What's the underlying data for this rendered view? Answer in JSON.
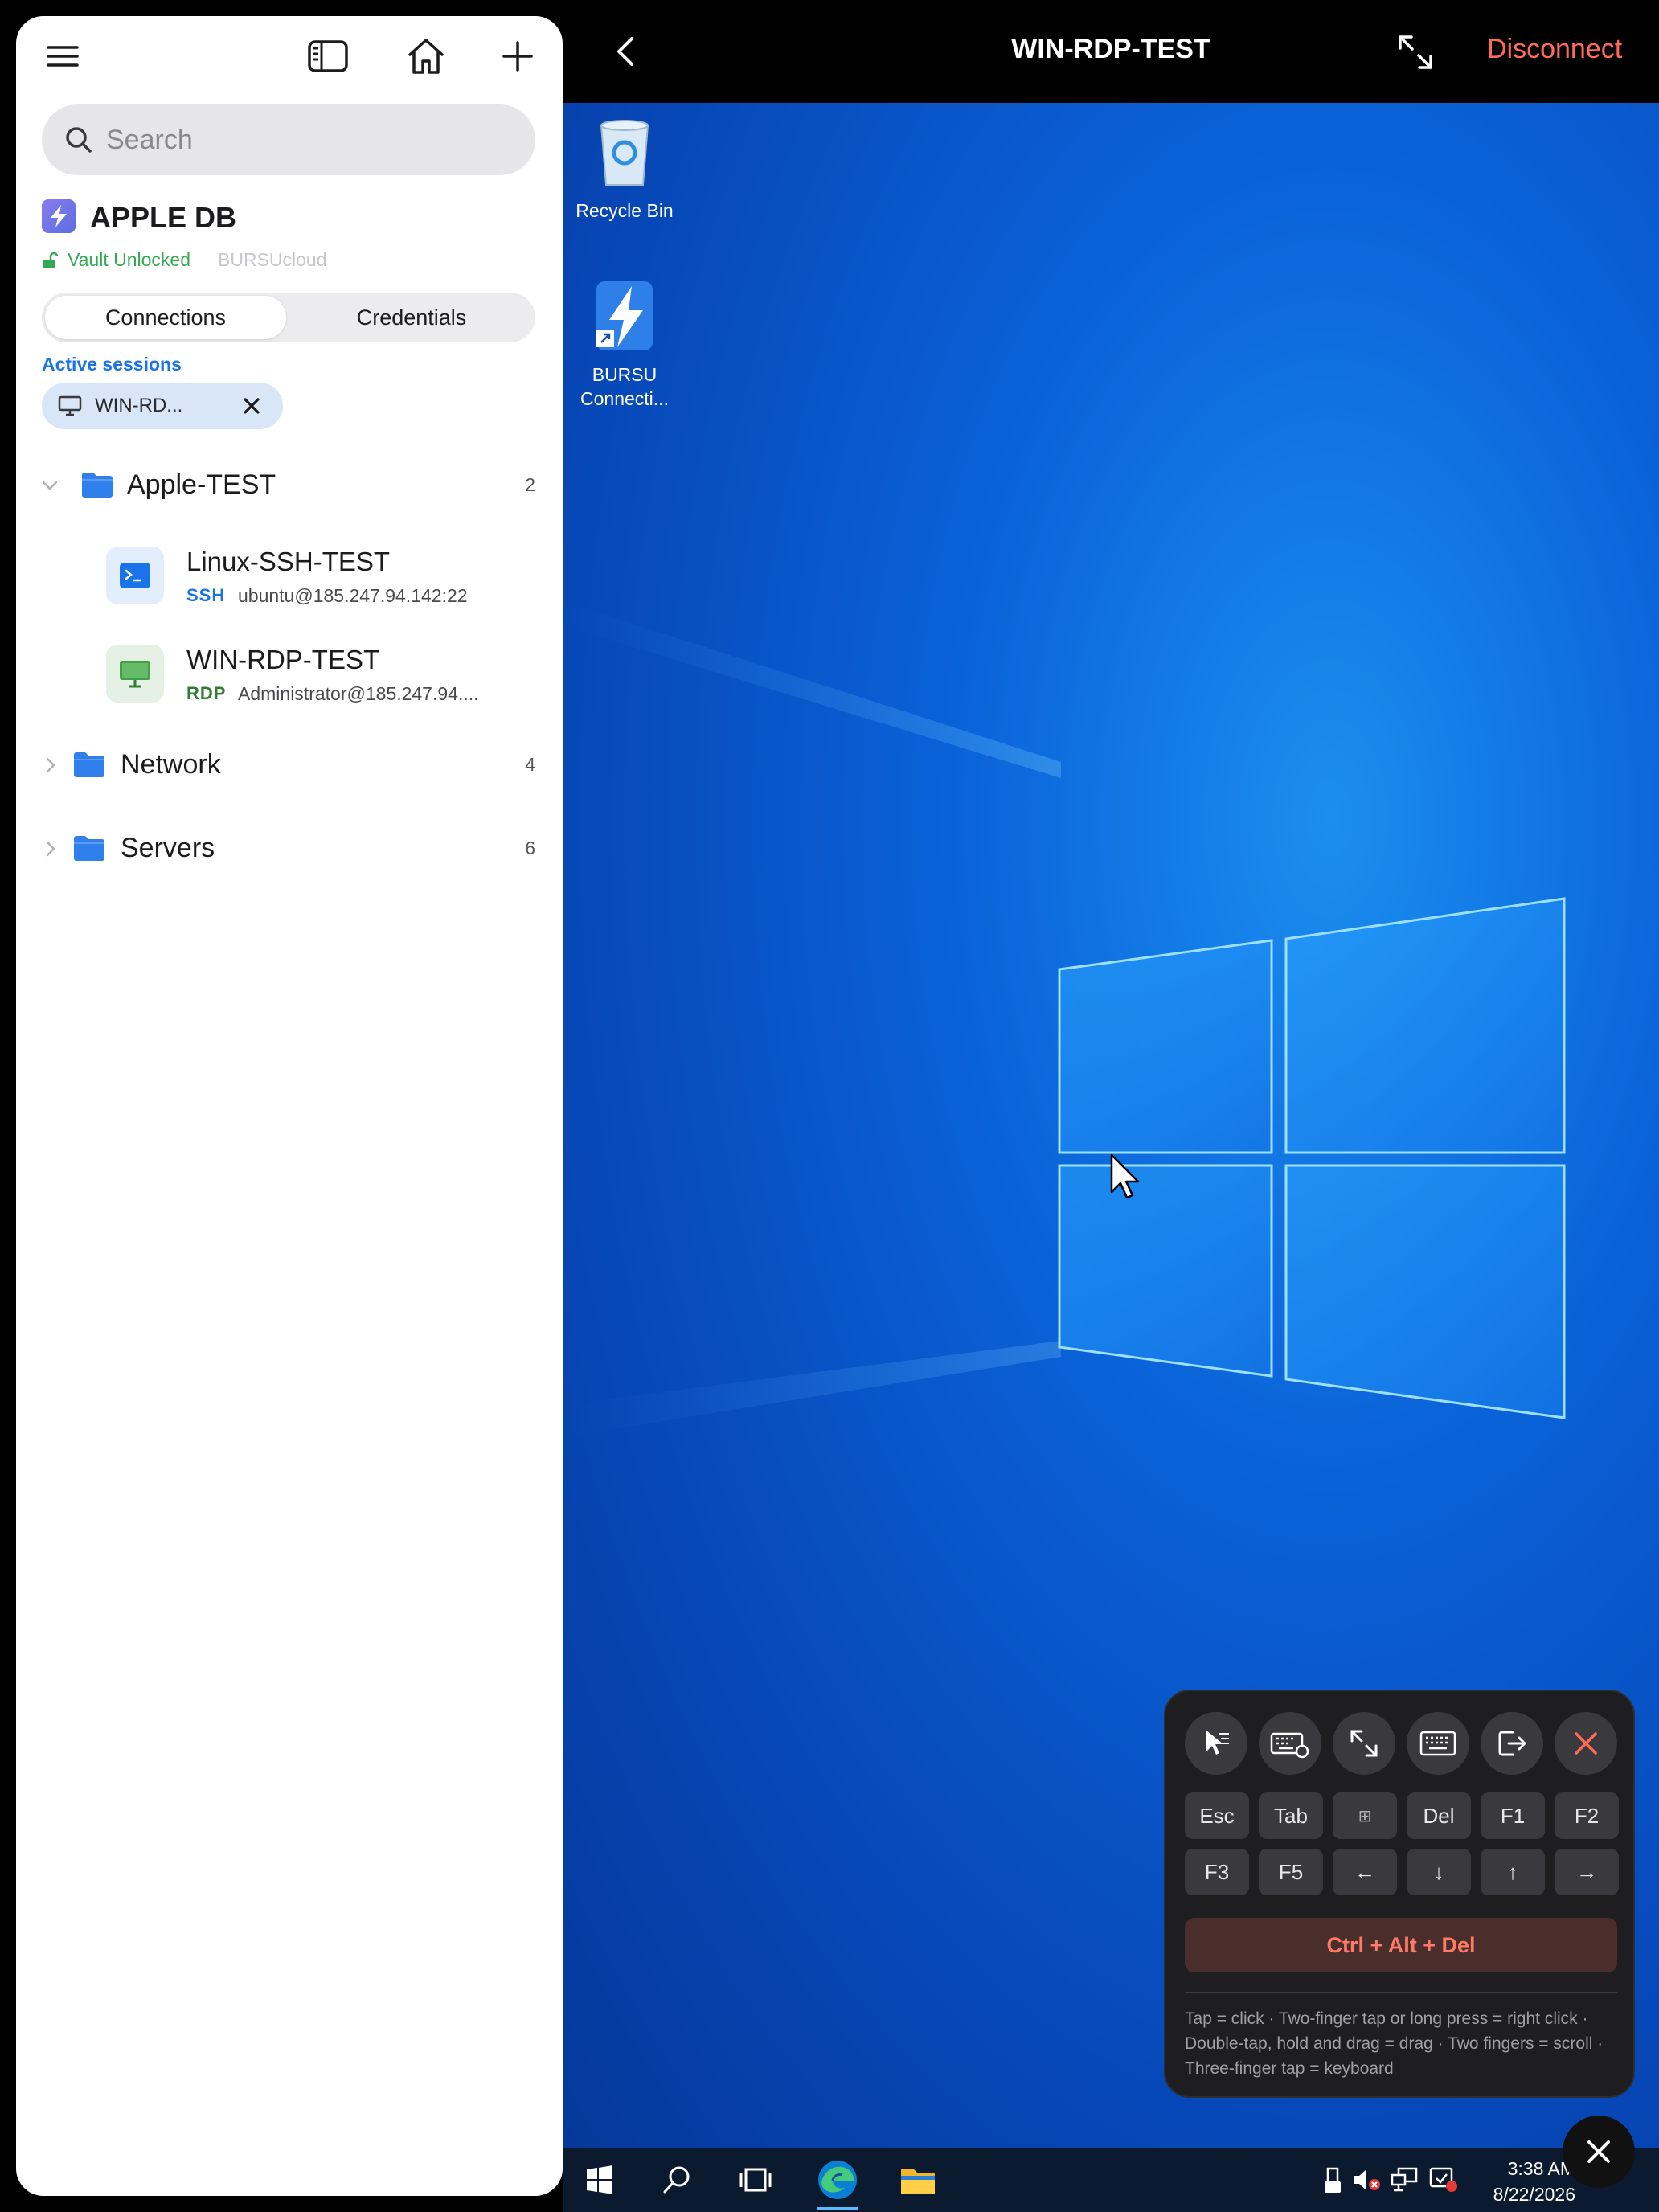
{
  "sidebar": {
    "search": {
      "placeholder": "Search"
    },
    "vault": {
      "name": "APPLE DB",
      "status": "Vault Unlocked",
      "cloud": "BURSUcloud"
    },
    "tabs": [
      {
        "label": "Connections",
        "active": true
      },
      {
        "label": "Credentials",
        "active": false
      }
    ],
    "active_sessions_label": "Active sessions",
    "active_session": {
      "label": "WIN-RD..."
    },
    "tree": {
      "apple_test": {
        "name": "Apple-TEST",
        "count": "2",
        "expanded": true
      },
      "linux": {
        "name": "Linux-SSH-TEST",
        "protocol": "SSH",
        "host": "ubuntu@185.247.94.142:22"
      },
      "win": {
        "name": "WIN-RDP-TEST",
        "protocol": "RDP",
        "host": "Administrator@185.247.94...."
      },
      "network": {
        "name": "Network",
        "count": "4",
        "expanded": false
      },
      "servers": {
        "name": "Servers",
        "count": "6",
        "expanded": false
      }
    }
  },
  "session": {
    "title": "WIN-RDP-TEST",
    "disconnect_label": "Disconnect"
  },
  "desktop": {
    "icons": [
      {
        "label": "Recycle Bin"
      },
      {
        "label": "BURSU Connecti..."
      }
    ],
    "clock": {
      "time": "3:38 AM",
      "date": "8/22/2026"
    }
  },
  "keyboard_panel": {
    "keys_row1": [
      "Esc",
      "Tab",
      "⊞",
      "Del",
      "F1",
      "F2"
    ],
    "keys_row2": [
      "F3",
      "F5",
      "←",
      "↓",
      "↑",
      "→"
    ],
    "cad_label": "Ctrl + Alt + Del",
    "help": "Tap = click · Two-finger tap or long press = right click · Double-tap, hold and drag = drag · Two fingers = scroll · Three-finger tap = keyboard"
  },
  "colors": {
    "accent_blue": "#1a73e8",
    "unlocked_green": "#34a853",
    "disconnect_red": "#ff6b57",
    "ssh_blue": "#1a73e8",
    "rdp_green": "#2e7d32"
  }
}
